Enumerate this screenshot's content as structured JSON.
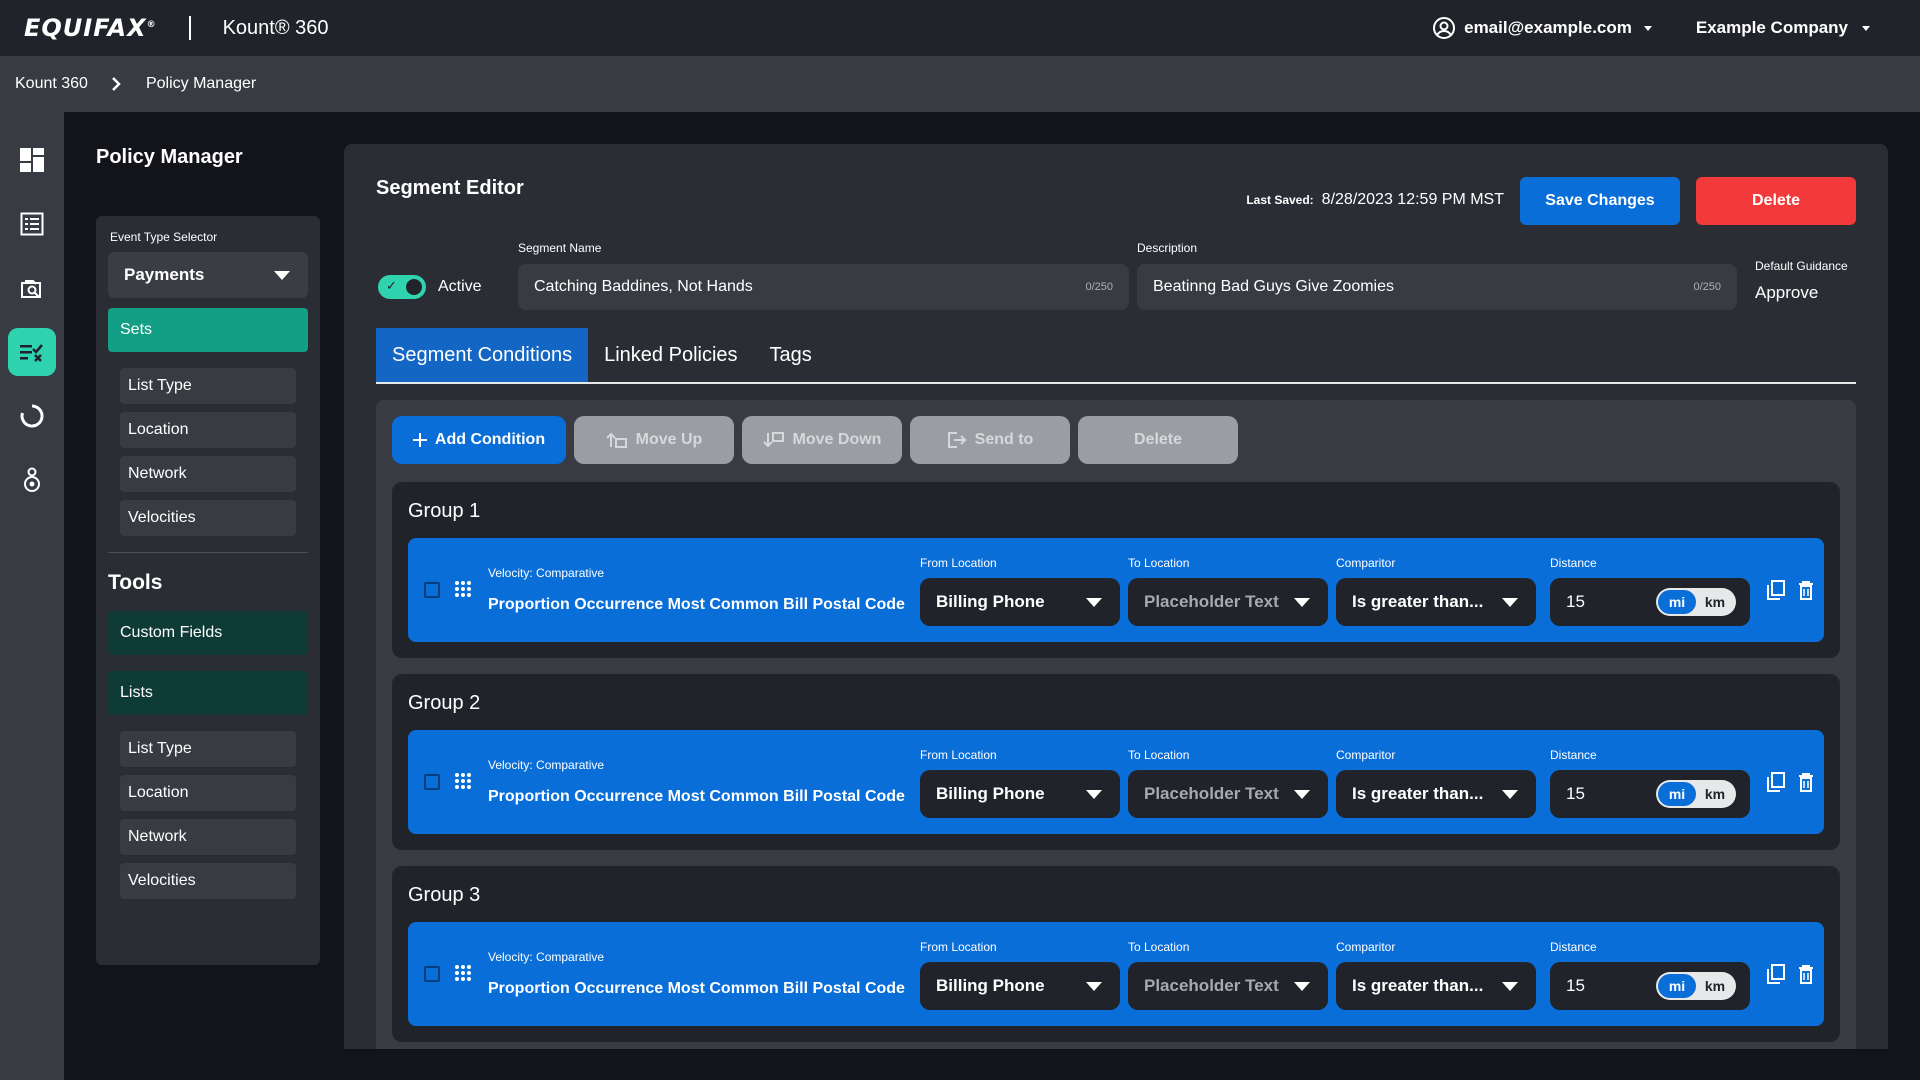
{
  "header": {
    "logo": "EQUIFAX",
    "product": "Kount® 360",
    "user_email": "email@example.com",
    "company": "Example Company"
  },
  "breadcrumb": [
    "Kount 360",
    "Policy Manager"
  ],
  "rail": {
    "icons": [
      "dashboard-icon",
      "list-icon",
      "search-document-icon",
      "policy-icon",
      "refresh-icon",
      "user-settings-icon"
    ],
    "active": "policy-icon"
  },
  "sidebar": {
    "title": "Policy Manager",
    "event_type_label": "Event Type Selector",
    "event_type_value": "Payments",
    "sets_label": "Sets",
    "set_items": [
      "List Type",
      "Location",
      "Network",
      "Velocities"
    ],
    "tools_title": "Tools",
    "tools": [
      "Custom Fields",
      "Lists"
    ],
    "tool_items": [
      "List Type",
      "Location",
      "Network",
      "Velocities"
    ]
  },
  "editor": {
    "title": "Segment Editor",
    "last_saved_label": "Last Saved:",
    "last_saved_value": "8/28/2023 12:59 PM MST",
    "save_label": "Save Changes",
    "delete_label": "Delete",
    "active_label": "Active",
    "active": true,
    "segment_name_label": "Segment Name",
    "segment_name_value": "Catching Baddines, Not Hands",
    "segment_name_count": "0/250",
    "description_label": "Description",
    "description_value": "Beatinng Bad Guys Give Zoomies",
    "description_count": "0/250",
    "default_guidance_label": "Default Guidance",
    "default_guidance_value": "Approve"
  },
  "tabs": [
    "Segment Conditions",
    "Linked Policies",
    "Tags"
  ],
  "active_tab": "Segment Conditions",
  "toolbar": {
    "add_condition": "Add Condition",
    "move_up": "Move Up",
    "move_down": "Move Down",
    "send_to": "Send to",
    "delete": "Delete"
  },
  "groups": [
    {
      "title": "Group 1",
      "condition": {
        "type_label": "Velocity: Comparative",
        "name": "Proportion Occurrence Most Common Bill Postal Code",
        "from_label": "From Location",
        "from_value": "Billing Phone",
        "to_label": "To Location",
        "to_value": "Placeholder Text",
        "comparator_label": "Comparitor",
        "comparator_value": "Is greater than...",
        "distance_label": "Distance",
        "distance_value": "15",
        "unit_mi": "mi",
        "unit_km": "km",
        "unit_selected": "mi"
      }
    },
    {
      "title": "Group 2",
      "condition": {
        "type_label": "Velocity: Comparative",
        "name": "Proportion Occurrence Most Common Bill Postal Code",
        "from_label": "From Location",
        "from_value": "Billing Phone",
        "to_label": "To Location",
        "to_value": "Placeholder Text",
        "comparator_label": "Comparitor",
        "comparator_value": "Is greater than...",
        "distance_label": "Distance",
        "distance_value": "15",
        "unit_mi": "mi",
        "unit_km": "km",
        "unit_selected": "mi"
      }
    },
    {
      "title": "Group 3",
      "condition": {
        "type_label": "Velocity: Comparative",
        "name": "Proportion Occurrence Most Common Bill Postal Code",
        "from_label": "From Location",
        "from_value": "Billing Phone",
        "to_label": "To Location",
        "to_value": "Placeholder Text",
        "comparator_label": "Comparitor",
        "comparator_value": "Is greater than...",
        "distance_label": "Distance",
        "distance_value": "15",
        "unit_mi": "mi",
        "unit_km": "km",
        "unit_selected": "mi"
      }
    }
  ],
  "colors": {
    "primary": "#0a6ed8",
    "danger": "#f23a3a",
    "accent": "#2fd3b0",
    "sets_active": "#139f86"
  }
}
